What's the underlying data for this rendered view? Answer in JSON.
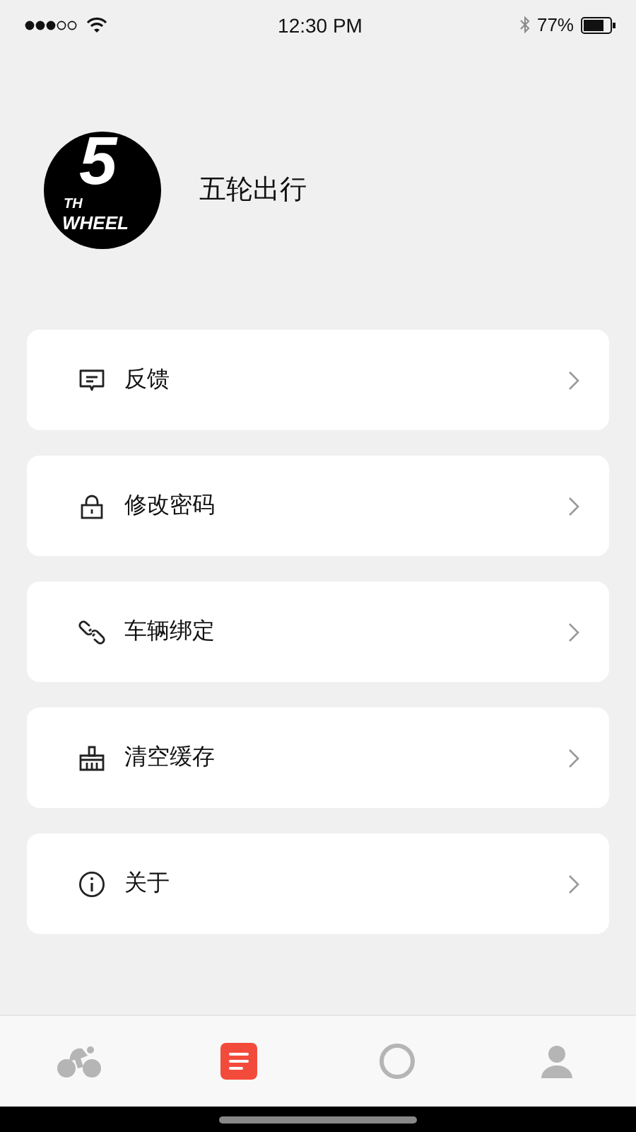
{
  "status_bar": {
    "time": "12:30 PM",
    "battery": "77%"
  },
  "profile": {
    "logo": {
      "numeral": "5",
      "superscript": "TH",
      "word": "WHEEL"
    },
    "name": "五轮出行"
  },
  "menu": [
    {
      "kind": "feedback",
      "label": "反馈"
    },
    {
      "kind": "lock",
      "label": "修改密码"
    },
    {
      "kind": "link",
      "label": "车辆绑定"
    },
    {
      "kind": "clean",
      "label": "清空缓存"
    },
    {
      "kind": "info",
      "label": "关于"
    }
  ],
  "tab_bar": [
    {
      "kind": "ride",
      "selected": false
    },
    {
      "kind": "list",
      "selected": true
    },
    {
      "kind": "circle",
      "selected": false
    },
    {
      "kind": "person",
      "selected": false
    }
  ]
}
